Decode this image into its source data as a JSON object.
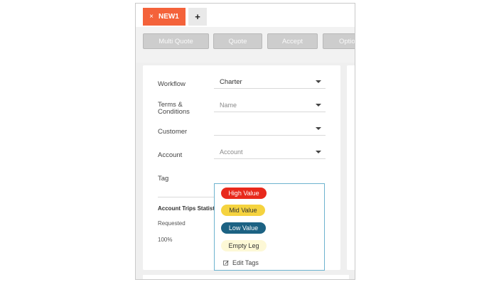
{
  "tabs": {
    "active_label": "NEW1",
    "close_glyph": "×",
    "add_glyph": "+"
  },
  "toolbar": {
    "buttons": [
      "Multi Quote",
      "Quote",
      "Accept",
      "Options"
    ]
  },
  "form": {
    "workflow": {
      "label": "Workflow",
      "value": "Charter"
    },
    "terms": {
      "label": "Terms & Conditions",
      "placeholder": "Name"
    },
    "customer": {
      "label": "Customer",
      "value": ""
    },
    "account": {
      "label": "Account",
      "placeholder": "Account"
    },
    "tag": {
      "label": "Tag"
    }
  },
  "stats": {
    "title": "Account Trips Statistics",
    "requested_label": "Requested",
    "requested_value": "100%"
  },
  "tag_menu": {
    "options": [
      {
        "label": "High Value",
        "color": "#e8291c",
        "text_color": "#ffffff"
      },
      {
        "label": "Mid Value",
        "color": "#f5d33f",
        "text_color": "#333333"
      },
      {
        "label": "Low Value",
        "color": "#1c6283",
        "text_color": "#ffffff"
      },
      {
        "label": "Empty Leg",
        "color": "#fdf8d6",
        "text_color": "#333333"
      }
    ],
    "edit_label": "Edit Tags"
  },
  "colors": {
    "accent": "#f4623a",
    "dropdown_border": "#6db3cf"
  }
}
